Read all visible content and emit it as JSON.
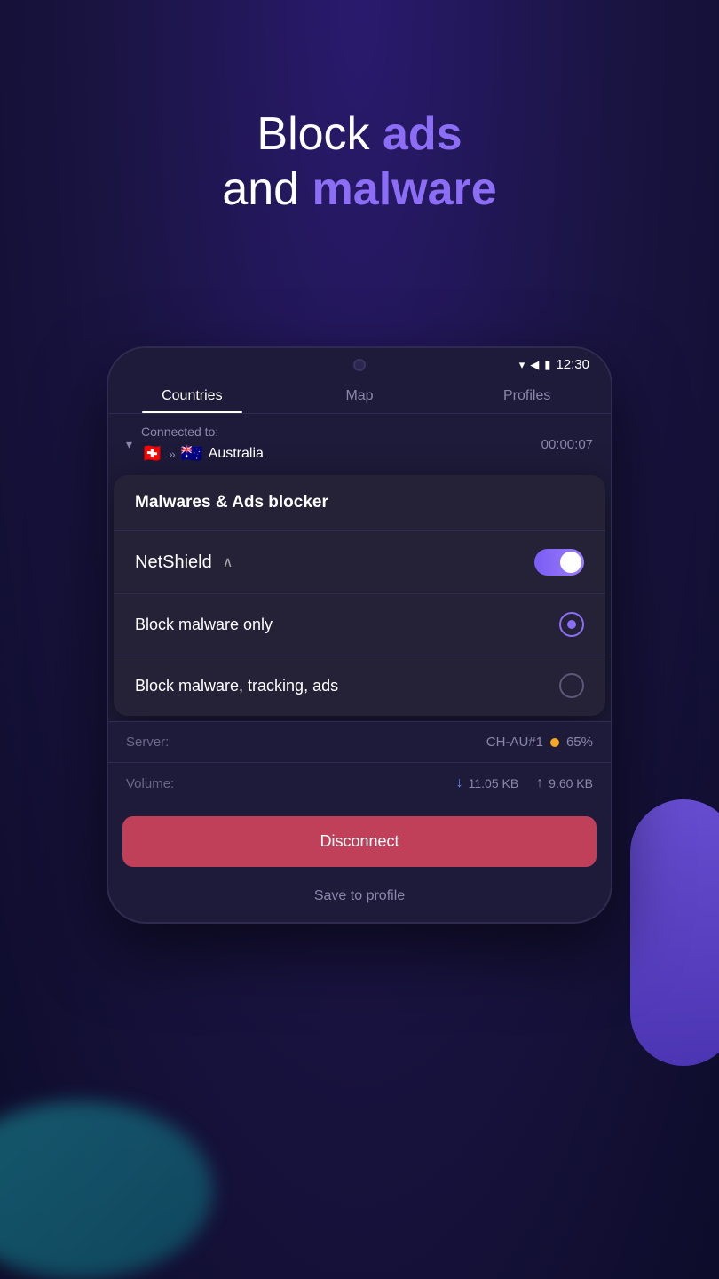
{
  "background": {
    "primary_color": "#1a1442",
    "secondary_color": "#2a1a6e"
  },
  "headline": {
    "line1_prefix": "Block ",
    "line1_highlight": "ads",
    "line2_prefix": "and ",
    "line2_highlight": "malware"
  },
  "phone": {
    "status_bar": {
      "time": "12:30"
    },
    "tabs": [
      {
        "label": "Countries",
        "active": true
      },
      {
        "label": "Map",
        "active": false
      },
      {
        "label": "Profiles",
        "active": false
      }
    ],
    "connection": {
      "label": "Connected to:",
      "from_flag": "🇨🇭",
      "to_flag": "🇦🇺",
      "country": "Australia",
      "timer": "00:00:07"
    },
    "malware_card": {
      "header": "Malwares & Ads blocker",
      "netshield_label": "NetShield",
      "options": [
        {
          "label": "Block malware only",
          "selected": true
        },
        {
          "label": "Block malware, tracking, ads",
          "selected": false
        }
      ]
    },
    "server": {
      "label": "Server:",
      "value": "CH-AU#1",
      "load_percent": "65%"
    },
    "volume": {
      "label": "Volume:",
      "download": "11.05 KB",
      "upload": "9.60 KB"
    },
    "disconnect_btn": "Disconnect",
    "save_profile": "Save to profile"
  }
}
